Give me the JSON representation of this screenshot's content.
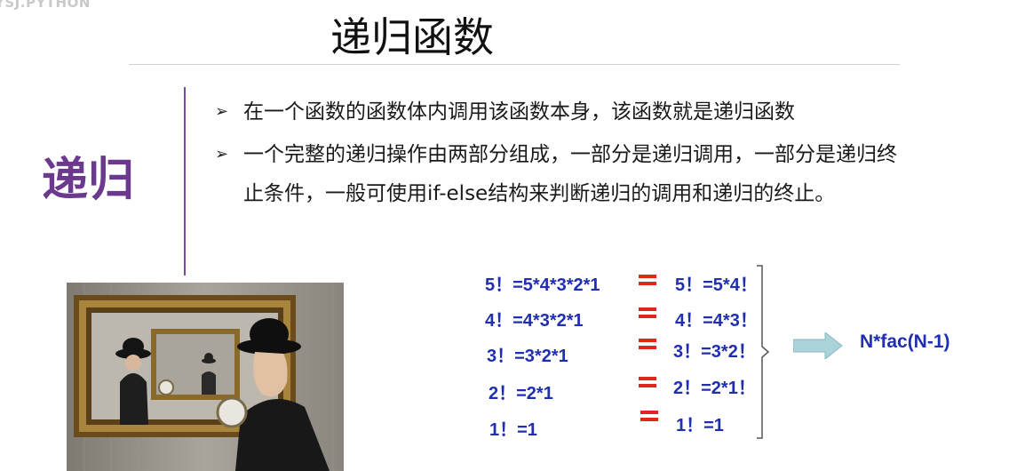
{
  "watermark": "YSJ.PYTHON",
  "title": "递归函数",
  "side_heading": "递归",
  "bullets": [
    "在一个函数的函数体内调用该函数本身，该函数就是递归函数",
    "一个完整的递归操作由两部分组成，一部分是递归调用，一部分是递归终止条件，一般可使用if-else结构来判断递归的调用和递归的终止。"
  ],
  "factorial_rows": [
    {
      "left": "5！=5*4*3*2*1",
      "right": "5！=5*4！"
    },
    {
      "left": "4！=4*3*2*1",
      "right": "4！=4*3！"
    },
    {
      "left": "3！=3*2*1",
      "right": "3！=3*2！"
    },
    {
      "left": "2！=2*1",
      "right": "2！=2*1！"
    },
    {
      "left": "1！=1",
      "right": "1！=1"
    }
  ],
  "result": "N*fac(N-1)",
  "photo": {
    "description_icon": "man-bowler-hat-mirror-image"
  },
  "colors": {
    "accent_purple": "#6b3a8f",
    "math_blue": "#1f2fb0",
    "equals_red": "#e0261e",
    "arrow_teal": "#a9d3d8"
  }
}
